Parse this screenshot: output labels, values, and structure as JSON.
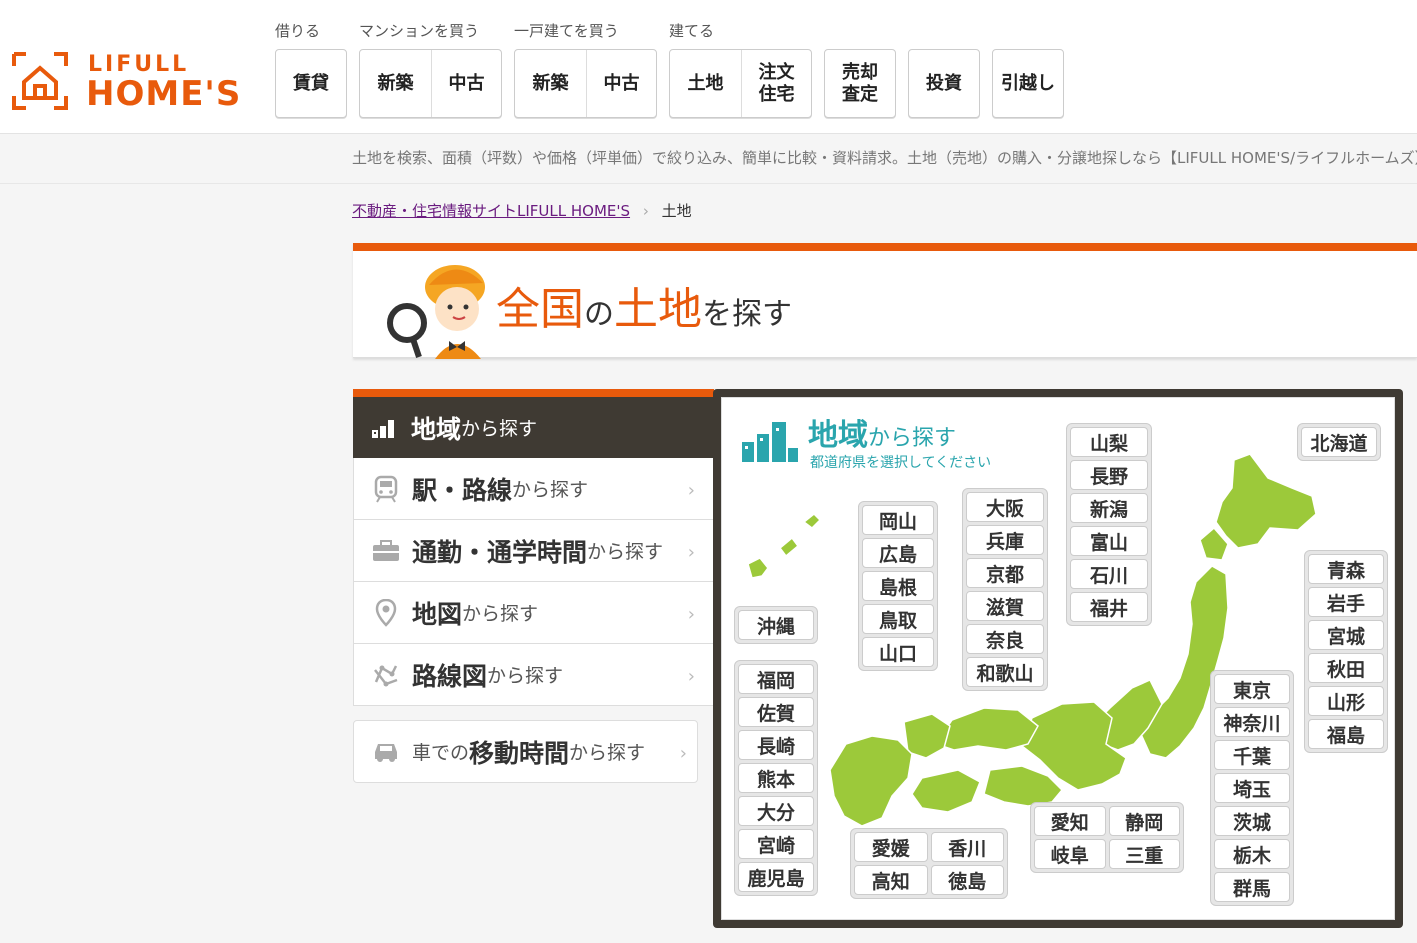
{
  "brand": {
    "line1": "LIFULL",
    "line2": "HOME'S"
  },
  "nav": {
    "groups": [
      {
        "label": "借りる"
      },
      {
        "label": "マンションを買う"
      },
      {
        "label": "一戸建てを買う"
      },
      {
        "label": "建てる"
      }
    ],
    "rent": "賃貸",
    "mansion_new": "新築",
    "mansion_used": "中古",
    "house_new": "新築",
    "house_used": "中古",
    "land": "土地",
    "custom_l1": "注文",
    "custom_l2": "住宅",
    "sell_l1": "売却",
    "sell_l2": "査定",
    "invest": "投資",
    "move": "引越し"
  },
  "tagline": "土地を検索、面積（坪数）や価格（坪単価）で絞り込み、簡単に比較・資料請求。土地（売地）の購入・分譲地探しなら【LIFULL HOME'S/ライフルホームズ】",
  "breadcrumb": {
    "home": "不動産・住宅情報サイトLIFULL HOME'S",
    "current": "土地"
  },
  "title": {
    "part1": "全国",
    "part2": "の",
    "part3": "土地",
    "part4": "を探す"
  },
  "menu": {
    "area": {
      "main": "地域",
      "sub": "から探す"
    },
    "station": {
      "main": "駅・路線",
      "sub": "から探す"
    },
    "commute": {
      "main": "通勤・通学時間",
      "sub": "から探す"
    },
    "map": {
      "main": "地図",
      "sub": "から探す"
    },
    "route": {
      "main": "路線図",
      "sub": "から探す"
    },
    "car": {
      "pre": "車での",
      "main": "移動時間",
      "sub": "から探す"
    }
  },
  "map": {
    "title_main": "地域",
    "title_sub": "から探す",
    "subtitle": "都道府県を選択してください",
    "hokkaido": [
      "北海道"
    ],
    "tohoku": [
      "青森",
      "岩手",
      "宮城",
      "秋田",
      "山形",
      "福島"
    ],
    "kanto": [
      "東京",
      "神奈川",
      "千葉",
      "埼玉",
      "茨城",
      "栃木",
      "群馬"
    ],
    "koshinetsu": [
      "山梨",
      "長野",
      "新潟",
      "富山",
      "石川",
      "福井"
    ],
    "kansai": [
      "大阪",
      "兵庫",
      "京都",
      "滋賀",
      "奈良",
      "和歌山"
    ],
    "chugoku": [
      "岡山",
      "広島",
      "島根",
      "鳥取",
      "山口"
    ],
    "okinawa": [
      "沖縄"
    ],
    "kyushu": [
      "福岡",
      "佐賀",
      "長崎",
      "熊本",
      "大分",
      "宮崎",
      "鹿児島"
    ],
    "shikoku": [
      "愛媛",
      "香川",
      "高知",
      "徳島"
    ],
    "tokai": [
      "愛知",
      "静岡",
      "岐阜",
      "三重"
    ]
  },
  "colors": {
    "accent": "#e85a0c",
    "dark": "#3f3a33",
    "teal": "#2aa5ad",
    "map_green": "#9cc93a"
  }
}
